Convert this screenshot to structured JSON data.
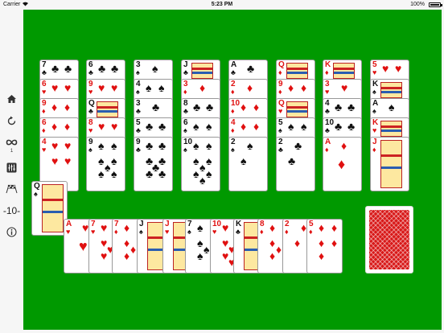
{
  "status_bar": {
    "carrier": "Carrier",
    "time": "5:23 PM",
    "battery": "100%"
  },
  "sidebar": {
    "items": [
      {
        "name": "home-icon",
        "kind": "icon"
      },
      {
        "name": "undo-icon",
        "kind": "icon"
      },
      {
        "name": "autoplay-icon",
        "kind": "icon",
        "badge": "1"
      },
      {
        "name": "settings-sliders-icon",
        "kind": "icon"
      },
      {
        "name": "checkered-flags-icon",
        "kind": "icon"
      },
      {
        "name": "score",
        "kind": "text",
        "label": "-10-"
      },
      {
        "name": "info-icon",
        "kind": "icon"
      }
    ]
  },
  "colors": {
    "felt": "#009900",
    "red_suit": "#e01010",
    "black_suit": "#111111",
    "card_back": "#d81818"
  },
  "tableau": [
    {
      "column": 1,
      "cards": [
        {
          "rank": "7",
          "suit": "clubs",
          "symbol": "♣",
          "color": "black"
        },
        {
          "rank": "6",
          "suit": "hearts",
          "symbol": "♥",
          "color": "red"
        },
        {
          "rank": "9",
          "suit": "diamonds",
          "symbol": "♦",
          "color": "red"
        },
        {
          "rank": "6",
          "suit": "diamonds",
          "symbol": "♦",
          "color": "red"
        },
        {
          "rank": "4",
          "suit": "hearts",
          "symbol": "♥",
          "color": "red"
        }
      ]
    },
    {
      "column": 2,
      "cards": [
        {
          "rank": "6",
          "suit": "clubs",
          "symbol": "♣",
          "color": "black"
        },
        {
          "rank": "9",
          "suit": "hearts",
          "symbol": "♥",
          "color": "red"
        },
        {
          "rank": "Q",
          "suit": "clubs",
          "symbol": "♣",
          "color": "black"
        },
        {
          "rank": "8",
          "suit": "hearts",
          "symbol": "♥",
          "color": "red"
        },
        {
          "rank": "9",
          "suit": "spades",
          "symbol": "♠",
          "color": "black"
        }
      ]
    },
    {
      "column": 3,
      "cards": [
        {
          "rank": "3",
          "suit": "spades",
          "symbol": "♠",
          "color": "black"
        },
        {
          "rank": "4",
          "suit": "spades",
          "symbol": "♠",
          "color": "black"
        },
        {
          "rank": "3",
          "suit": "clubs",
          "symbol": "♣",
          "color": "black"
        },
        {
          "rank": "5",
          "suit": "clubs",
          "symbol": "♣",
          "color": "black"
        },
        {
          "rank": "9",
          "suit": "clubs",
          "symbol": "♣",
          "color": "black"
        }
      ]
    },
    {
      "column": 4,
      "cards": [
        {
          "rank": "J",
          "suit": "clubs",
          "symbol": "♣",
          "color": "black"
        },
        {
          "rank": "3",
          "suit": "diamonds",
          "symbol": "♦",
          "color": "red"
        },
        {
          "rank": "8",
          "suit": "clubs",
          "symbol": "♣",
          "color": "black"
        },
        {
          "rank": "6",
          "suit": "spades",
          "symbol": "♠",
          "color": "black"
        },
        {
          "rank": "10",
          "suit": "spades",
          "symbol": "♠",
          "color": "black"
        }
      ]
    },
    {
      "column": 5,
      "cards": [
        {
          "rank": "A",
          "suit": "clubs",
          "symbol": "♣",
          "color": "black"
        },
        {
          "rank": "2",
          "suit": "diamonds",
          "symbol": "♦",
          "color": "red"
        },
        {
          "rank": "10",
          "suit": "diamonds",
          "symbol": "♦",
          "color": "red"
        },
        {
          "rank": "4",
          "suit": "diamonds",
          "symbol": "♦",
          "color": "red"
        },
        {
          "rank": "2",
          "suit": "spades",
          "symbol": "♠",
          "color": "black"
        }
      ]
    },
    {
      "column": 6,
      "cards": [
        {
          "rank": "Q",
          "suit": "diamonds",
          "symbol": "♦",
          "color": "red"
        },
        {
          "rank": "9",
          "suit": "diamonds",
          "symbol": "♦",
          "color": "red"
        },
        {
          "rank": "Q",
          "suit": "hearts",
          "symbol": "♥",
          "color": "red"
        },
        {
          "rank": "5",
          "suit": "spades",
          "symbol": "♠",
          "color": "black"
        },
        {
          "rank": "2",
          "suit": "clubs",
          "symbol": "♣",
          "color": "black"
        }
      ]
    },
    {
      "column": 7,
      "cards": [
        {
          "rank": "K",
          "suit": "diamonds",
          "symbol": "♦",
          "color": "red"
        },
        {
          "rank": "3",
          "suit": "hearts",
          "symbol": "♥",
          "color": "red"
        },
        {
          "rank": "4",
          "suit": "clubs",
          "symbol": "♣",
          "color": "black"
        },
        {
          "rank": "10",
          "suit": "clubs",
          "symbol": "♣",
          "color": "black"
        },
        {
          "rank": "A",
          "suit": "diamonds",
          "symbol": "♦",
          "color": "red"
        }
      ]
    },
    {
      "column": 8,
      "cards": [
        {
          "rank": "5",
          "suit": "hearts",
          "symbol": "♥",
          "color": "red"
        },
        {
          "rank": "K",
          "suit": "spades",
          "symbol": "♠",
          "color": "black"
        },
        {
          "rank": "A",
          "suit": "spades",
          "symbol": "♠",
          "color": "black"
        },
        {
          "rank": "K",
          "suit": "hearts",
          "symbol": "♥",
          "color": "red"
        },
        {
          "rank": "J",
          "suit": "diamonds",
          "symbol": "♦",
          "color": "red"
        }
      ]
    }
  ],
  "waste": [
    {
      "rank": "Q",
      "suit": "spades",
      "symbol": "♠",
      "color": "black"
    },
    {
      "rank": "A",
      "suit": "hearts",
      "symbol": "♥",
      "color": "red"
    },
    {
      "rank": "7",
      "suit": "hearts",
      "symbol": "♥",
      "color": "red"
    },
    {
      "rank": "7",
      "suit": "diamonds",
      "symbol": "♦",
      "color": "red"
    },
    {
      "rank": "J",
      "suit": "spades",
      "symbol": "♠",
      "color": "black"
    },
    {
      "rank": "J",
      "suit": "hearts",
      "symbol": "♥",
      "color": "red"
    },
    {
      "rank": "7",
      "suit": "spades",
      "symbol": "♠",
      "color": "black"
    },
    {
      "rank": "10",
      "suit": "hearts",
      "symbol": "♥",
      "color": "red"
    },
    {
      "rank": "K",
      "suit": "clubs",
      "symbol": "♣",
      "color": "black"
    },
    {
      "rank": "8",
      "suit": "diamonds",
      "symbol": "♦",
      "color": "red"
    },
    {
      "rank": "2",
      "suit": "diamonds",
      "symbol": "♦",
      "color": "red"
    },
    {
      "rank": "5",
      "suit": "diamonds",
      "symbol": "♦",
      "color": "red"
    }
  ],
  "stock": {
    "face_down": true
  }
}
